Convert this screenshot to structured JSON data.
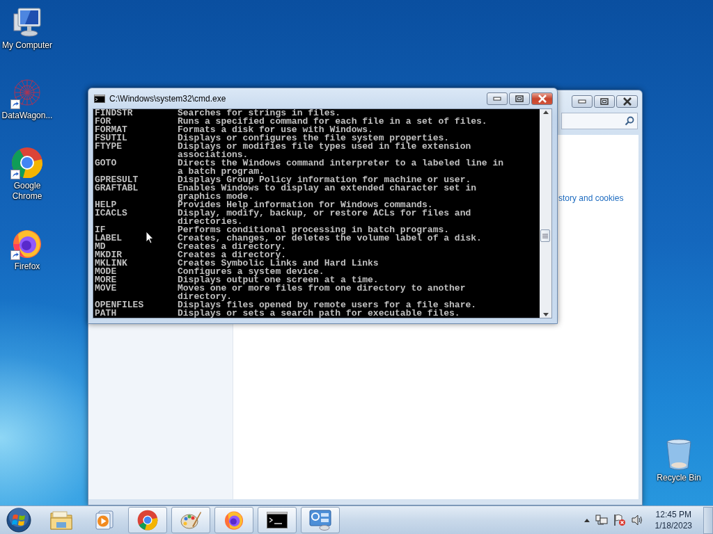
{
  "desktop_icons": [
    {
      "label": "My Computer",
      "kind": "computer",
      "shortcut": false
    },
    {
      "label": "DataWagon...",
      "kind": "network",
      "shortcut": true
    },
    {
      "label": "Google Chrome",
      "kind": "chrome",
      "shortcut": true
    },
    {
      "label": "Firefox",
      "kind": "firefox",
      "shortcut": true
    }
  ],
  "recycle_bin": {
    "label": "Recycle Bin"
  },
  "background_window": {
    "link_text": "story and cookies"
  },
  "cmd_window": {
    "title": "C:\\Windows\\system32\\cmd.exe",
    "lines": [
      {
        "command": "FINDSTR",
        "text": "Searches for strings in files."
      },
      {
        "command": "FOR",
        "text": "Runs a specified command for each file in a set of files."
      },
      {
        "command": "FORMAT",
        "text": "Formats a disk for use with Windows."
      },
      {
        "command": "FSUTIL",
        "text": "Displays or configures the file system properties."
      },
      {
        "command": "FTYPE",
        "text": "Displays or modifies file types used in file extension"
      },
      {
        "text": "associations."
      },
      {
        "command": "GOTO",
        "text": "Directs the Windows command interpreter to a labeled line in"
      },
      {
        "text": "a batch program."
      },
      {
        "command": "GPRESULT",
        "text": "Displays Group Policy information for machine or user."
      },
      {
        "command": "GRAFTABL",
        "text": "Enables Windows to display an extended character set in"
      },
      {
        "text": "graphics mode."
      },
      {
        "command": "HELP",
        "text": "Provides Help information for Windows commands."
      },
      {
        "command": "ICACLS",
        "text": "Display, modify, backup, or restore ACLs for files and"
      },
      {
        "text": "directories."
      },
      {
        "command": "IF",
        "text": "Performs conditional processing in batch programs."
      },
      {
        "command": "LABEL",
        "text": "Creates, changes, or deletes the volume label of a disk."
      },
      {
        "command": "MD",
        "text": "Creates a directory."
      },
      {
        "command": "MKDIR",
        "text": "Creates a directory."
      },
      {
        "command": "MKLINK",
        "text": "Creates Symbolic Links and Hard Links"
      },
      {
        "command": "MODE",
        "text": "Configures a system device."
      },
      {
        "command": "MORE",
        "text": "Displays output one screen at a time."
      },
      {
        "command": "MOVE",
        "text": "Moves one or more files from one directory to another"
      },
      {
        "text": "directory."
      },
      {
        "command": "OPENFILES",
        "text": "Displays files opened by remote users for a file share."
      },
      {
        "command": "PATH",
        "text": "Displays or sets a search path for executable files."
      }
    ]
  },
  "taskbar": {
    "apps": [
      {
        "kind": "explorer",
        "running": false
      },
      {
        "kind": "media",
        "running": false
      },
      {
        "kind": "chrome",
        "running": true
      },
      {
        "kind": "paint",
        "running": true
      },
      {
        "kind": "firefox",
        "running": true
      },
      {
        "kind": "console",
        "running": true
      },
      {
        "kind": "control",
        "running": true
      }
    ],
    "clock": {
      "time": "12:45 PM",
      "date": "1/18/2023"
    }
  }
}
